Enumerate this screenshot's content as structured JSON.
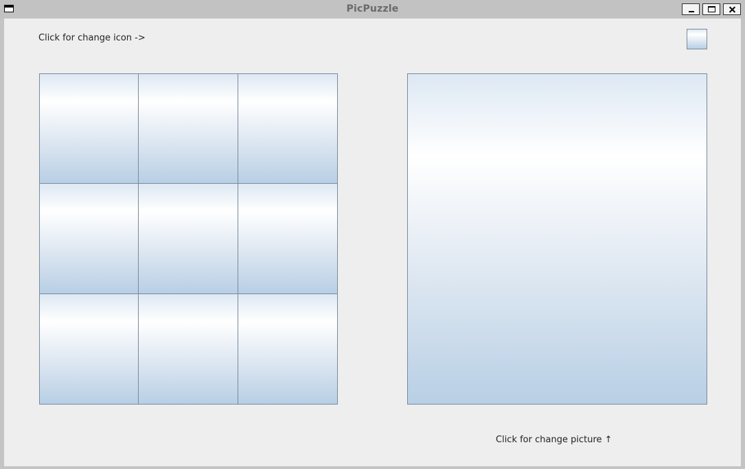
{
  "window": {
    "title": "PicPuzzle"
  },
  "content": {
    "icon_label": "Click for change icon ->",
    "picture_label": "Click for change picture ↑",
    "puzzle": {
      "rows": 3,
      "cols": 3,
      "tiles": [
        "",
        "",
        "",
        "",
        "",
        "",
        "",
        "",
        ""
      ]
    }
  },
  "colors": {
    "background": "#eeeeee",
    "title": "#6a6a6a",
    "button_border": "#7a8a9a",
    "button_gradient_top": "#ffffff",
    "button_gradient_bottom": "#b8cfe5"
  },
  "icons": {
    "system_menu": "window-menu-icon",
    "minimize": "minimize-icon",
    "maximize": "maximize-icon",
    "close": "close-icon"
  }
}
